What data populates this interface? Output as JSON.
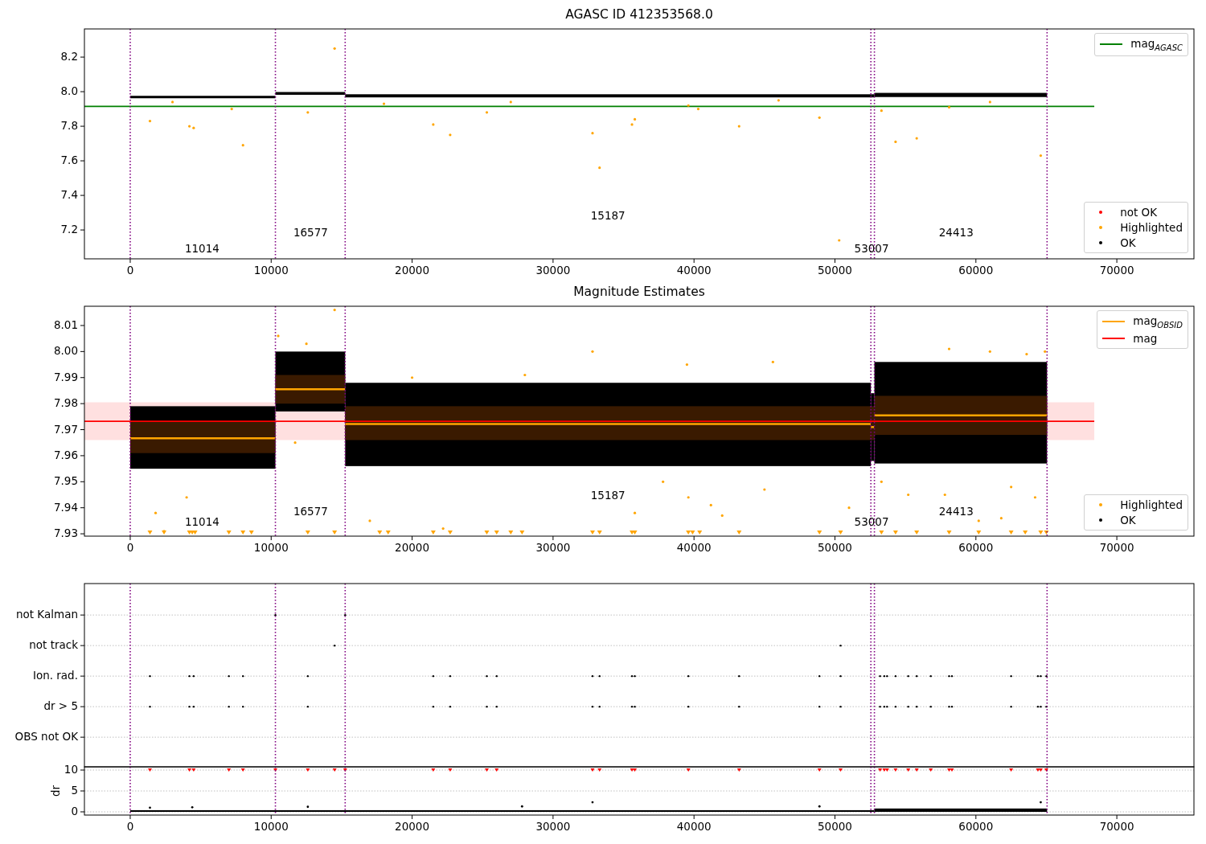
{
  "figure": {
    "panels": [
      {
        "kind": "magnitude",
        "title": "AGASC ID 412353568.0",
        "yticks": [
          "8.2",
          "8.0",
          "7.8",
          "7.6",
          "7.4",
          "7.2"
        ],
        "xticks": [
          "0",
          "10000",
          "20000",
          "30000",
          "40000",
          "50000",
          "60000",
          "70000"
        ],
        "segment_labels": [
          "11014",
          "16577",
          "15187",
          "53007",
          "24413"
        ],
        "legends": [
          {
            "items": [
              {
                "kind": "line",
                "label": "mag$_{AGASC}$",
                "color": "#008000"
              }
            ]
          },
          {
            "items": [
              {
                "kind": "dot",
                "label": "not OK",
                "color": "#ff0000"
              },
              {
                "kind": "dot",
                "label": "Highlighted",
                "color": "#ffa500"
              },
              {
                "kind": "dot",
                "label": "OK",
                "color": "#000000"
              }
            ]
          }
        ]
      },
      {
        "kind": "estimates",
        "title": "Magnitude Estimates",
        "yticks": [
          "8.01",
          "8.00",
          "7.99",
          "7.98",
          "7.97",
          "7.96",
          "7.95",
          "7.94",
          "7.93"
        ],
        "xticks": [
          "0",
          "10000",
          "20000",
          "30000",
          "40000",
          "50000",
          "60000",
          "70000"
        ],
        "segment_labels": [
          "11014",
          "16577",
          "15187",
          "53007",
          "24413"
        ],
        "legends": [
          {
            "items": [
              {
                "kind": "line",
                "label": "mag$_{OBSID}$",
                "color": "#ffa500"
              },
              {
                "kind": "line",
                "label": "mag",
                "color": "#ff0000"
              }
            ]
          },
          {
            "items": [
              {
                "kind": "dot",
                "label": "Highlighted",
                "color": "#ffa500"
              },
              {
                "kind": "dot",
                "label": "OK",
                "color": "#000000"
              }
            ]
          }
        ]
      },
      {
        "kind": "flags",
        "rows": [
          "not Kalman",
          "not track",
          "Ion. rad.",
          "dr > 5",
          "OBS not OK"
        ]
      },
      {
        "kind": "dr",
        "ylabel": "dr",
        "yticks": [
          "10",
          "5",
          "0"
        ],
        "xticks": [
          "0",
          "10000",
          "20000",
          "30000",
          "40000",
          "50000",
          "60000",
          "70000"
        ]
      }
    ]
  }
}
